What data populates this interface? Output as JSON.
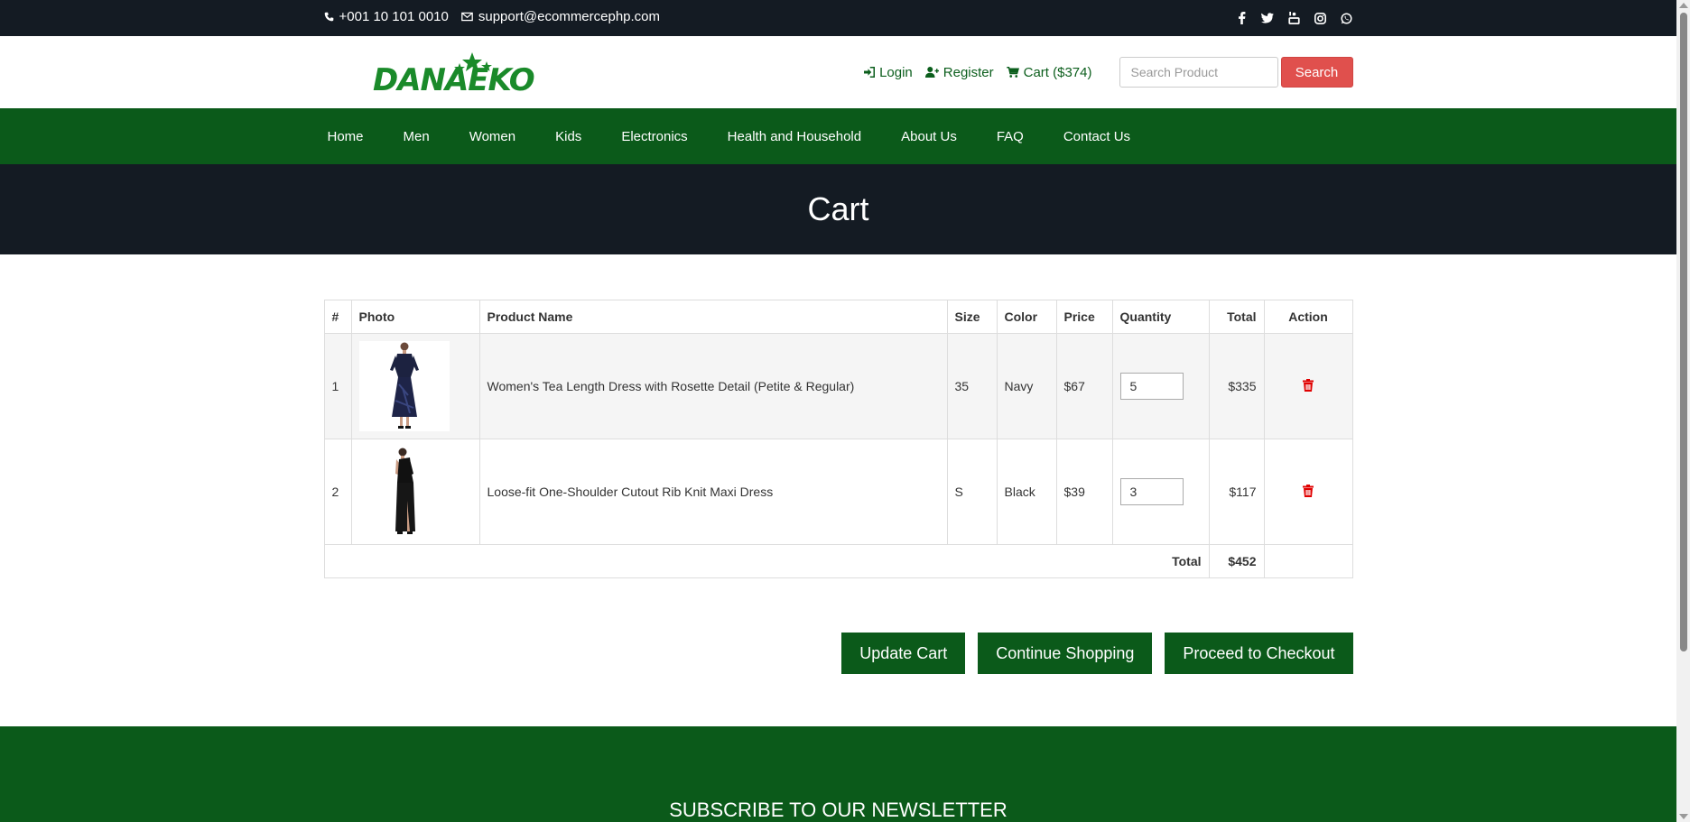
{
  "topbar": {
    "phone": "+001 10 101 0010",
    "email": "support@ecommercephp.com",
    "social_icons": [
      "facebook-icon",
      "twitter-icon",
      "youtube-icon",
      "instagram-icon",
      "whatsapp-icon"
    ]
  },
  "header": {
    "logo_text": "DANAEKO",
    "login": "Login",
    "register": "Register",
    "cart": "Cart ($374)",
    "search_placeholder": "Search Product",
    "search_button": "Search"
  },
  "nav": {
    "items": [
      "Home",
      "Men",
      "Women",
      "Kids",
      "Electronics",
      "Health and Household",
      "About Us",
      "FAQ",
      "Contact Us"
    ]
  },
  "banner": {
    "title": "Cart"
  },
  "cart": {
    "headers": [
      "#",
      "Photo",
      "Product Name",
      "Size",
      "Color",
      "Price",
      "Quantity",
      "Total",
      "Action"
    ],
    "rows": [
      {
        "num": "1",
        "name": "Women's Tea Length Dress with Rosette Detail (Petite & Regular)",
        "size": "35",
        "color": "Navy",
        "price": "$67",
        "quantity": "5",
        "total": "$335"
      },
      {
        "num": "2",
        "name": "Loose-fit One-Shoulder Cutout Rib Knit Maxi Dress",
        "size": "S",
        "color": "Black",
        "price": "$39",
        "quantity": "3",
        "total": "$117"
      }
    ],
    "total_label": "Total",
    "total_value": "$452"
  },
  "buttons": {
    "update": "Update Cart",
    "continue": "Continue Shopping",
    "checkout": "Proceed to Checkout"
  },
  "newsletter": {
    "title": "SUBSCRIBE TO OUR NEWSLETTER"
  },
  "colors": {
    "dark": "#141b23",
    "green": "#0b5a1a",
    "search_button": "#e0504d",
    "delete_icon": "#e00000"
  }
}
